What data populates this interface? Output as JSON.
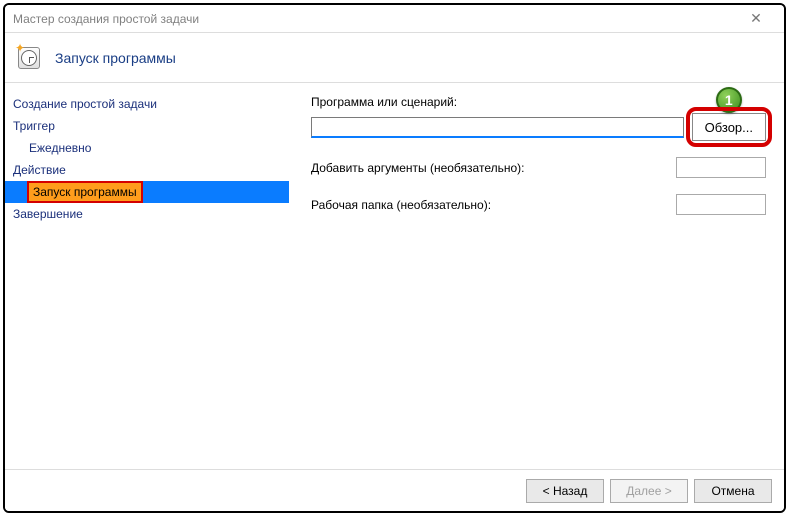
{
  "window": {
    "title": "Мастер создания простой задачи"
  },
  "header": {
    "title": "Запуск программы"
  },
  "sidebar": {
    "items": [
      {
        "label": "Создание простой задачи",
        "indent": 0
      },
      {
        "label": "Триггер",
        "indent": 0
      },
      {
        "label": "Ежедневно",
        "indent": 1
      },
      {
        "label": "Действие",
        "indent": 0
      },
      {
        "label": "Запуск программы",
        "indent": 1,
        "selected": true
      },
      {
        "label": "Завершение",
        "indent": 0
      }
    ]
  },
  "content": {
    "program_label": "Программа или сценарий:",
    "program_value": "",
    "browse_label": "Обзор...",
    "args_label": "Добавить аргументы (необязательно):",
    "args_value": "",
    "startin_label": "Рабочая папка (необязательно):",
    "startin_value": ""
  },
  "footer": {
    "back": "< Назад",
    "next": "Далее >",
    "cancel": "Отмена"
  },
  "annotation": {
    "badge": "1"
  }
}
